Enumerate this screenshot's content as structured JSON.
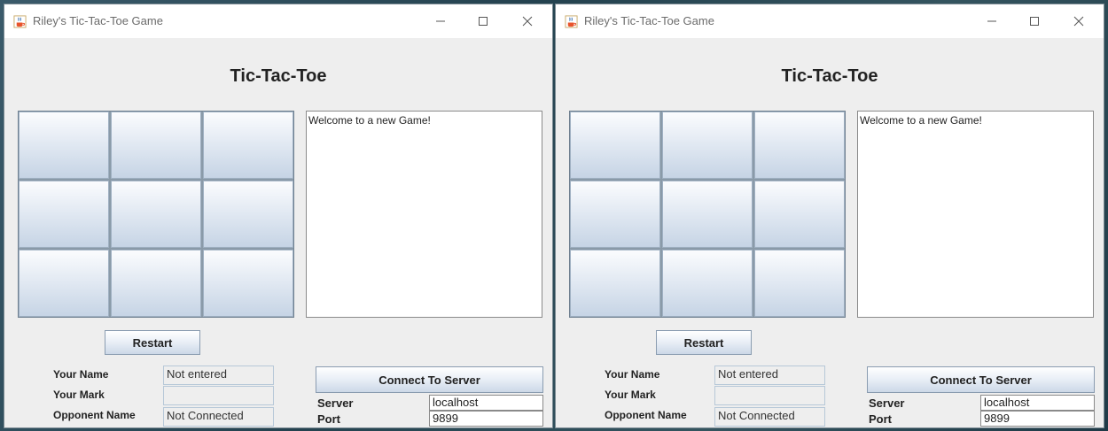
{
  "windows": [
    {
      "title": "Riley's Tic-Tac-Toe Game",
      "heading": "Tic-Tac-Toe",
      "message_log": "Welcome to a new Game!",
      "restart_label": "Restart",
      "connect_label": "Connect To Server",
      "your_name_label": "Your Name",
      "your_name_value": "Not entered",
      "your_mark_label": "Your Mark",
      "your_mark_value": "",
      "opponent_label": "Opponent Name",
      "opponent_value": "Not Connected",
      "server_label": "Server",
      "server_value": "localhost",
      "port_label": "Port",
      "port_value": "9899"
    },
    {
      "title": "Riley's Tic-Tac-Toe Game",
      "heading": "Tic-Tac-Toe",
      "message_log": "Welcome to a new Game!",
      "restart_label": "Restart",
      "connect_label": "Connect To Server",
      "your_name_label": "Your Name",
      "your_name_value": "Not entered",
      "your_mark_label": "Your Mark",
      "your_mark_value": "",
      "opponent_label": "Opponent Name",
      "opponent_value": "Not Connected",
      "server_label": "Server",
      "server_value": "localhost",
      "port_label": "Port",
      "port_value": "9899"
    }
  ],
  "icons": {
    "app": "java-coffee-cup-icon",
    "minimize": "minimize-icon",
    "maximize": "maximize-icon",
    "close": "close-icon"
  },
  "colors": {
    "window_bg": "#eeeeee",
    "cell_top": "#fbfcfe",
    "cell_bottom": "#c6d4e5",
    "title_text": "#6b6b6b"
  }
}
